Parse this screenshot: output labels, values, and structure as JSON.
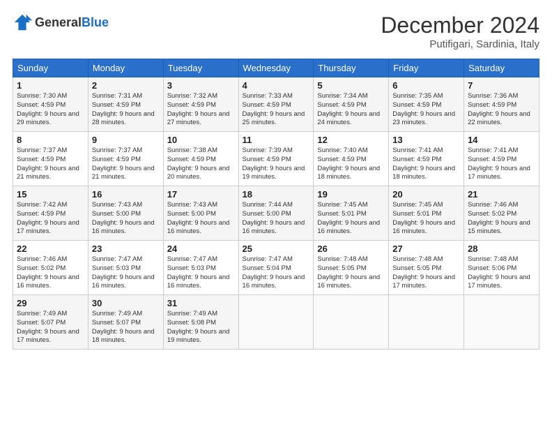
{
  "header": {
    "logo_general": "General",
    "logo_blue": "Blue",
    "month_year": "December 2024",
    "location": "Putifigari, Sardinia, Italy"
  },
  "weekdays": [
    "Sunday",
    "Monday",
    "Tuesday",
    "Wednesday",
    "Thursday",
    "Friday",
    "Saturday"
  ],
  "weeks": [
    [
      {
        "day": "1",
        "sunrise": "Sunrise: 7:30 AM",
        "sunset": "Sunset: 4:59 PM",
        "daylight": "Daylight: 9 hours and 29 minutes."
      },
      {
        "day": "2",
        "sunrise": "Sunrise: 7:31 AM",
        "sunset": "Sunset: 4:59 PM",
        "daylight": "Daylight: 9 hours and 28 minutes."
      },
      {
        "day": "3",
        "sunrise": "Sunrise: 7:32 AM",
        "sunset": "Sunset: 4:59 PM",
        "daylight": "Daylight: 9 hours and 27 minutes."
      },
      {
        "day": "4",
        "sunrise": "Sunrise: 7:33 AM",
        "sunset": "Sunset: 4:59 PM",
        "daylight": "Daylight: 9 hours and 25 minutes."
      },
      {
        "day": "5",
        "sunrise": "Sunrise: 7:34 AM",
        "sunset": "Sunset: 4:59 PM",
        "daylight": "Daylight: 9 hours and 24 minutes."
      },
      {
        "day": "6",
        "sunrise": "Sunrise: 7:35 AM",
        "sunset": "Sunset: 4:59 PM",
        "daylight": "Daylight: 9 hours and 23 minutes."
      },
      {
        "day": "7",
        "sunrise": "Sunrise: 7:36 AM",
        "sunset": "Sunset: 4:59 PM",
        "daylight": "Daylight: 9 hours and 22 minutes."
      }
    ],
    [
      {
        "day": "8",
        "sunrise": "Sunrise: 7:37 AM",
        "sunset": "Sunset: 4:59 PM",
        "daylight": "Daylight: 9 hours and 21 minutes."
      },
      {
        "day": "9",
        "sunrise": "Sunrise: 7:37 AM",
        "sunset": "Sunset: 4:59 PM",
        "daylight": "Daylight: 9 hours and 21 minutes."
      },
      {
        "day": "10",
        "sunrise": "Sunrise: 7:38 AM",
        "sunset": "Sunset: 4:59 PM",
        "daylight": "Daylight: 9 hours and 20 minutes."
      },
      {
        "day": "11",
        "sunrise": "Sunrise: 7:39 AM",
        "sunset": "Sunset: 4:59 PM",
        "daylight": "Daylight: 9 hours and 19 minutes."
      },
      {
        "day": "12",
        "sunrise": "Sunrise: 7:40 AM",
        "sunset": "Sunset: 4:59 PM",
        "daylight": "Daylight: 9 hours and 18 minutes."
      },
      {
        "day": "13",
        "sunrise": "Sunrise: 7:41 AM",
        "sunset": "Sunset: 4:59 PM",
        "daylight": "Daylight: 9 hours and 18 minutes."
      },
      {
        "day": "14",
        "sunrise": "Sunrise: 7:41 AM",
        "sunset": "Sunset: 4:59 PM",
        "daylight": "Daylight: 9 hours and 17 minutes."
      }
    ],
    [
      {
        "day": "15",
        "sunrise": "Sunrise: 7:42 AM",
        "sunset": "Sunset: 4:59 PM",
        "daylight": "Daylight: 9 hours and 17 minutes."
      },
      {
        "day": "16",
        "sunrise": "Sunrise: 7:43 AM",
        "sunset": "Sunset: 5:00 PM",
        "daylight": "Daylight: 9 hours and 16 minutes."
      },
      {
        "day": "17",
        "sunrise": "Sunrise: 7:43 AM",
        "sunset": "Sunset: 5:00 PM",
        "daylight": "Daylight: 9 hours and 16 minutes."
      },
      {
        "day": "18",
        "sunrise": "Sunrise: 7:44 AM",
        "sunset": "Sunset: 5:00 PM",
        "daylight": "Daylight: 9 hours and 16 minutes."
      },
      {
        "day": "19",
        "sunrise": "Sunrise: 7:45 AM",
        "sunset": "Sunset: 5:01 PM",
        "daylight": "Daylight: 9 hours and 16 minutes."
      },
      {
        "day": "20",
        "sunrise": "Sunrise: 7:45 AM",
        "sunset": "Sunset: 5:01 PM",
        "daylight": "Daylight: 9 hours and 16 minutes."
      },
      {
        "day": "21",
        "sunrise": "Sunrise: 7:46 AM",
        "sunset": "Sunset: 5:02 PM",
        "daylight": "Daylight: 9 hours and 15 minutes."
      }
    ],
    [
      {
        "day": "22",
        "sunrise": "Sunrise: 7:46 AM",
        "sunset": "Sunset: 5:02 PM",
        "daylight": "Daylight: 9 hours and 16 minutes."
      },
      {
        "day": "23",
        "sunrise": "Sunrise: 7:47 AM",
        "sunset": "Sunset: 5:03 PM",
        "daylight": "Daylight: 9 hours and 16 minutes."
      },
      {
        "day": "24",
        "sunrise": "Sunrise: 7:47 AM",
        "sunset": "Sunset: 5:03 PM",
        "daylight": "Daylight: 9 hours and 16 minutes."
      },
      {
        "day": "25",
        "sunrise": "Sunrise: 7:47 AM",
        "sunset": "Sunset: 5:04 PM",
        "daylight": "Daylight: 9 hours and 16 minutes."
      },
      {
        "day": "26",
        "sunrise": "Sunrise: 7:48 AM",
        "sunset": "Sunset: 5:05 PM",
        "daylight": "Daylight: 9 hours and 16 minutes."
      },
      {
        "day": "27",
        "sunrise": "Sunrise: 7:48 AM",
        "sunset": "Sunset: 5:05 PM",
        "daylight": "Daylight: 9 hours and 17 minutes."
      },
      {
        "day": "28",
        "sunrise": "Sunrise: 7:48 AM",
        "sunset": "Sunset: 5:06 PM",
        "daylight": "Daylight: 9 hours and 17 minutes."
      }
    ],
    [
      {
        "day": "29",
        "sunrise": "Sunrise: 7:49 AM",
        "sunset": "Sunset: 5:07 PM",
        "daylight": "Daylight: 9 hours and 17 minutes."
      },
      {
        "day": "30",
        "sunrise": "Sunrise: 7:49 AM",
        "sunset": "Sunset: 5:07 PM",
        "daylight": "Daylight: 9 hours and 18 minutes."
      },
      {
        "day": "31",
        "sunrise": "Sunrise: 7:49 AM",
        "sunset": "Sunset: 5:08 PM",
        "daylight": "Daylight: 9 hours and 19 minutes."
      },
      null,
      null,
      null,
      null
    ]
  ]
}
